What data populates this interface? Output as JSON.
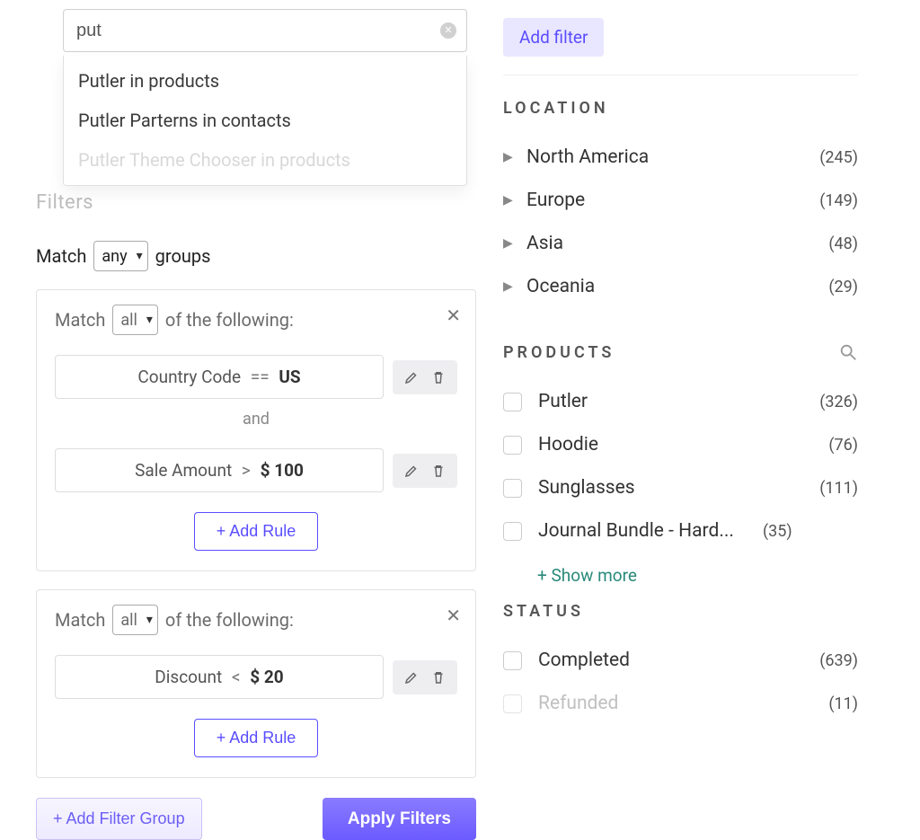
{
  "search": {
    "value": "put",
    "suggestions": [
      "Putler in products",
      "Putler Parterns in contacts",
      "Putler Theme Chooser in products"
    ]
  },
  "filters": {
    "title": "Filters",
    "match_prefix": "Match",
    "match_scope": "any",
    "match_suffix": "groups",
    "group_match_prefix": "Match",
    "group_match_suffix": "of the following:",
    "add_rule_label": "+ Add Rule",
    "add_group_label": "+ Add Filter Group",
    "apply_label": "Apply Filters",
    "and_label": "and",
    "groups": [
      {
        "scope": "all",
        "rules": [
          {
            "field": "Country Code",
            "op": "==",
            "value": "US"
          },
          {
            "field": "Sale Amount",
            "op": ">",
            "value": "$ 100"
          }
        ]
      },
      {
        "scope": "all",
        "rules": [
          {
            "field": "Discount",
            "op": "<",
            "value": "$ 20"
          }
        ]
      }
    ]
  },
  "sidebar": {
    "add_filter_label": "Add filter",
    "location_title": "LOCATION",
    "locations": [
      {
        "label": "North America",
        "count": "(245)"
      },
      {
        "label": "Europe",
        "count": "(149)"
      },
      {
        "label": "Asia",
        "count": "(48)"
      },
      {
        "label": "Oceania",
        "count": "(29)"
      }
    ],
    "products_title": "PRODUCTS",
    "products": [
      {
        "label": "Putler",
        "count": "(326)"
      },
      {
        "label": "Hoodie",
        "count": "(76)"
      },
      {
        "label": "Sunglasses",
        "count": "(111)"
      },
      {
        "label": "Journal Bundle - Hard...",
        "count": "(35)"
      }
    ],
    "show_more_label": "+ Show more",
    "status_title": "STATUS",
    "statuses": [
      {
        "label": "Completed",
        "count": "(639)"
      },
      {
        "label": "Refunded",
        "count": "(11)"
      }
    ]
  }
}
